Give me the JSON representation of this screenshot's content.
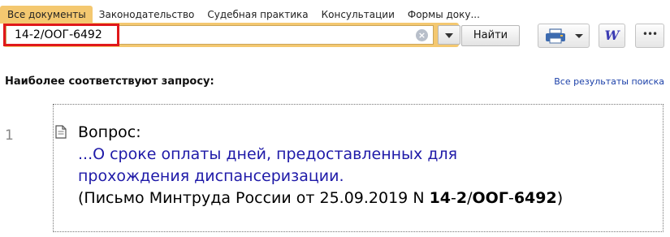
{
  "tabs": [
    {
      "label": "Все документы",
      "active": true
    },
    {
      "label": "Законодательство",
      "active": false
    },
    {
      "label": "Судебная практика",
      "active": false
    },
    {
      "label": "Консультации",
      "active": false
    },
    {
      "label": "Формы доку...",
      "active": false
    }
  ],
  "search": {
    "value": "14-2/ООГ-6492",
    "find_label": "Найти"
  },
  "toolbar": {
    "word_label": "W",
    "more_label": "•••"
  },
  "results": {
    "heading": "Наиболее соответствуют запросу:",
    "all_results_link": "Все результаты поиска",
    "items": [
      {
        "number": "1",
        "label": "Вопрос:",
        "link_line1": "...О сроке оплаты дней, предоставленных для",
        "link_line2": "прохождения диспансеризации.",
        "source_prefix": "(Письмо Минтруда России от 25.09.2019 N ",
        "source_bold1": "14",
        "source_mid1": "-",
        "source_bold2": "2",
        "source_mid2": "/",
        "source_bold3": "ООГ",
        "source_mid3": "-",
        "source_bold4": "6492",
        "source_suffix": ")"
      }
    ]
  },
  "colors": {
    "tab_active": "#f4c870",
    "link": "#1f1aa8",
    "highlight": "#e0181a"
  }
}
